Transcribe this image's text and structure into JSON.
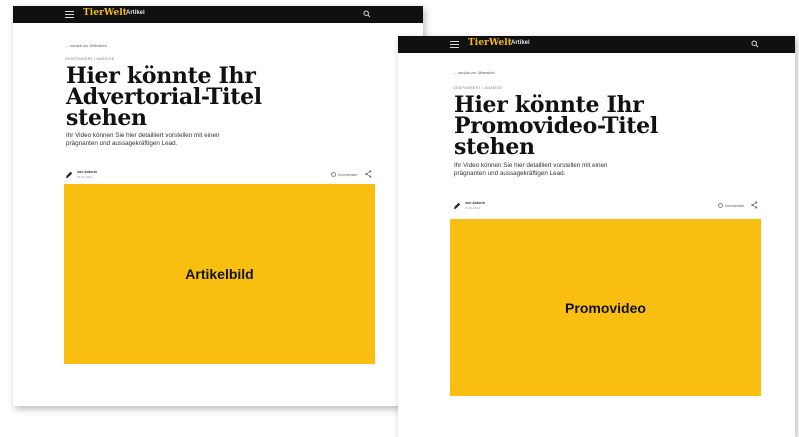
{
  "colors": {
    "brand_yellow": "#f9bf10",
    "topbar": "#101010",
    "logo_text": "#f5bd14"
  },
  "icons": [
    "hamburger-icon",
    "search-icon",
    "back-arrow-icon",
    "pencil-icon",
    "comment-icon",
    "share-icon"
  ],
  "card_a": {
    "logo": "TierWelt",
    "nav_label": "Artikel",
    "back_link": "← zurück zur Übersicht",
    "kicker": "GESPONSERT / ANZEIGE",
    "headline": [
      "Hier könnte Ihr",
      "Advertorial-Titel",
      "stehen"
    ],
    "lead": [
      "Ihr Video können Sie hier detailliert vorstellen mit einen",
      "prägnanten und aussagekräftigen Lead."
    ],
    "author": "von Autorin",
    "date": "01.01.2024",
    "comment_label": "Kommentare",
    "media_label": "Artikelbild"
  },
  "card_b": {
    "logo": "TierWelt",
    "nav_label": "Artikel",
    "back_link": "← zurück zur Übersicht",
    "kicker": "GESPONSERT / ANZEIGE",
    "headline": [
      "Hier könnte Ihr",
      "Promovideo-Titel",
      "stehen"
    ],
    "lead": [
      "Ihr Video können Sie hier detailliert vorstellen mit einen",
      "prägnanten und aussagekräftigen Lead."
    ],
    "author": "von Autorin",
    "date": "01.01.2024",
    "comment_label": "Kommentare",
    "media_label": "Promovideo"
  }
}
